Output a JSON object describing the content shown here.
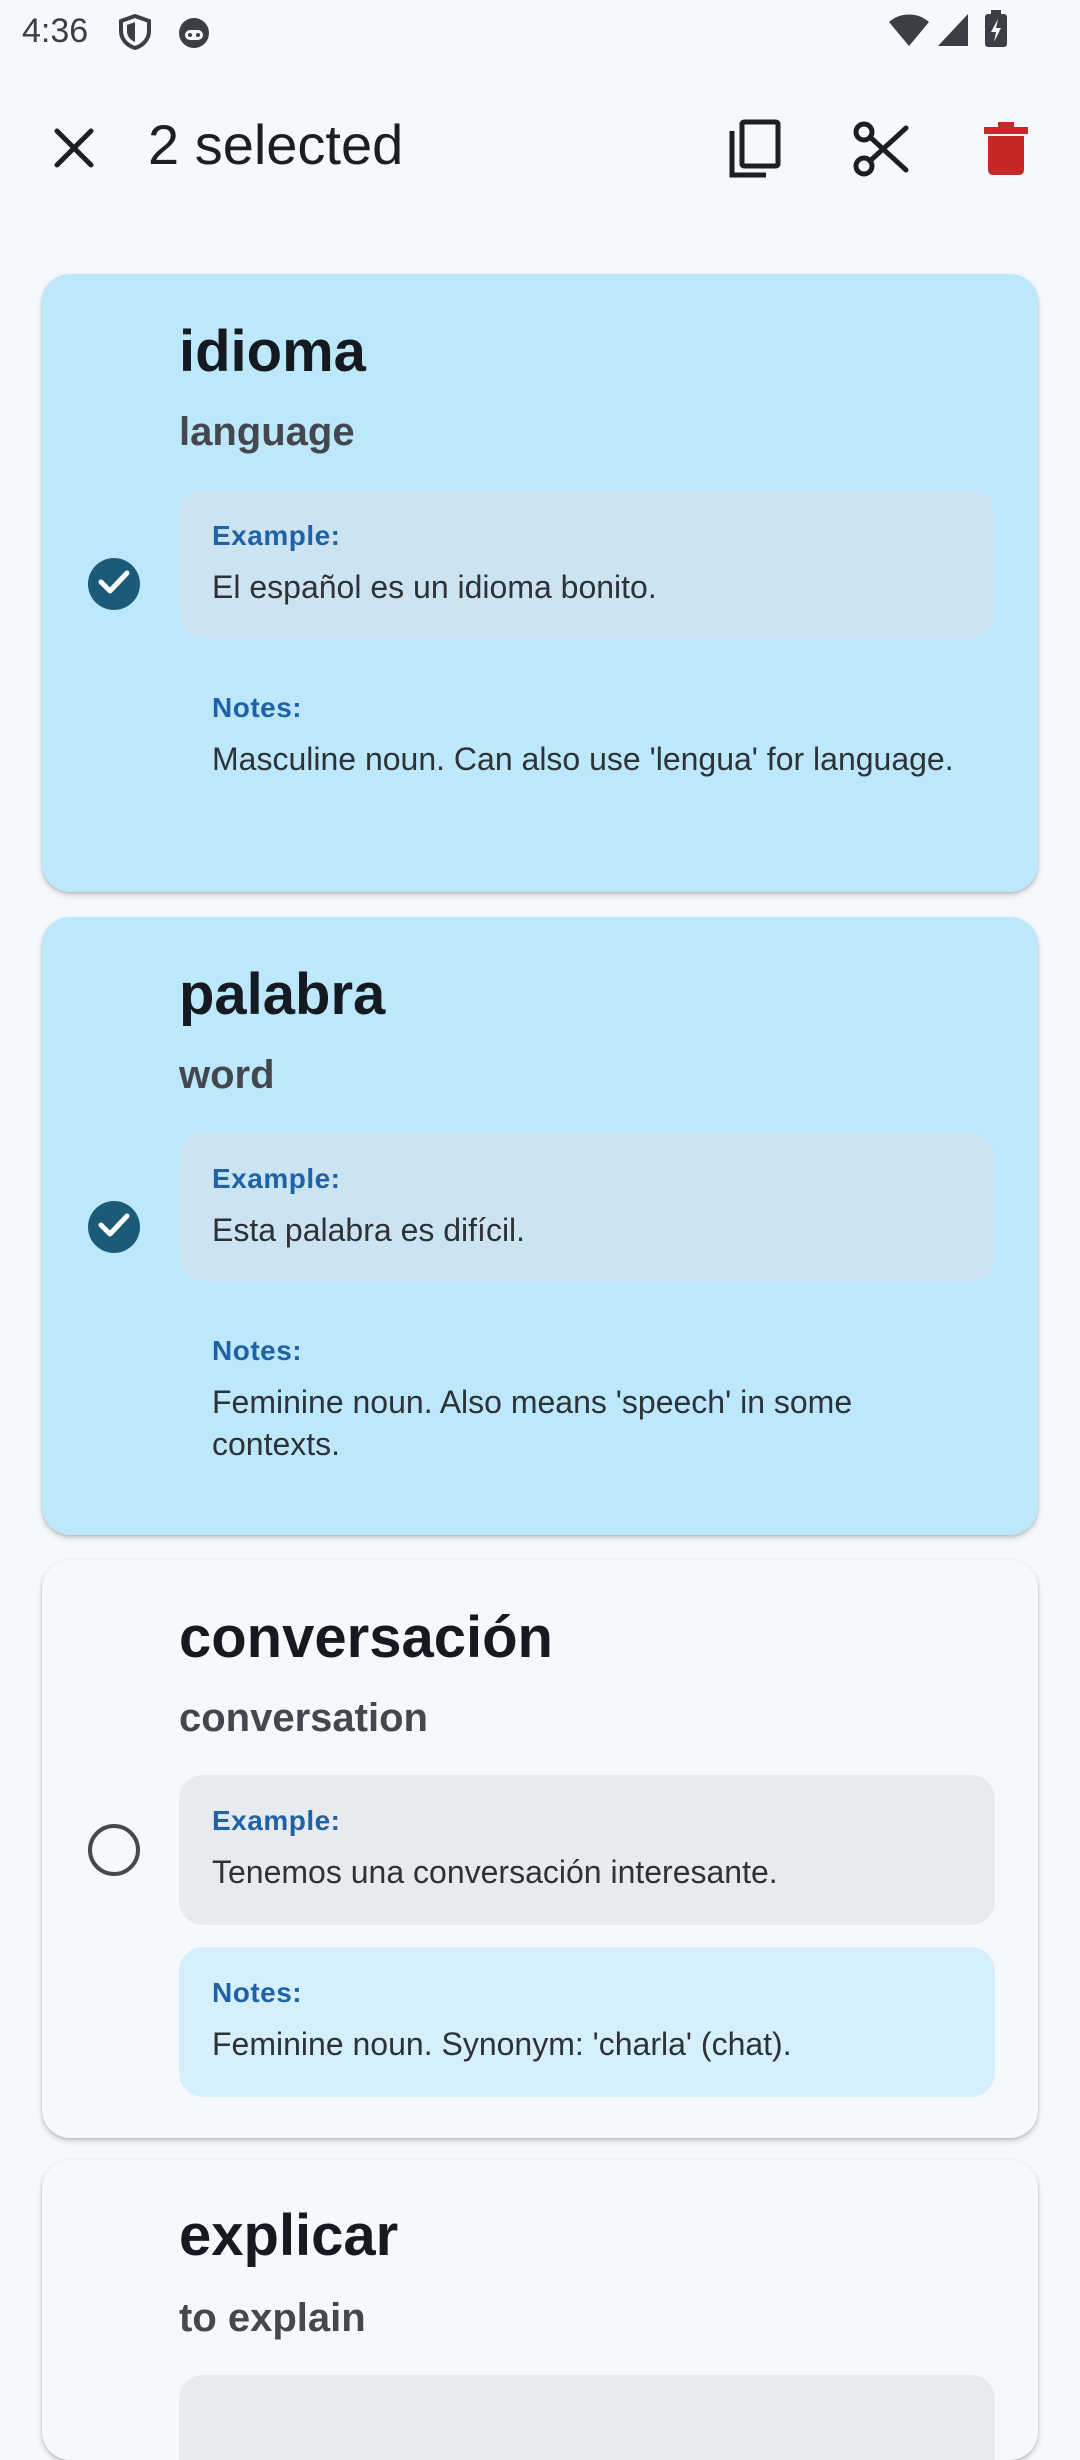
{
  "status_bar": {
    "time": "4:36",
    "icons": [
      "shield-icon",
      "android-icon",
      "wifi-icon",
      "signal-icon",
      "battery-charging-icon"
    ]
  },
  "app_bar": {
    "close_icon": "close-icon",
    "title": "2 selected",
    "actions": [
      {
        "name": "copy",
        "icon": "copy-icon"
      },
      {
        "name": "cut",
        "icon": "scissors-icon"
      },
      {
        "name": "delete",
        "icon": "trash-icon",
        "color": "#c62828"
      }
    ]
  },
  "cards": [
    {
      "term": "idioma",
      "translation": "language",
      "selected": true,
      "example_label": "Example:",
      "example": "El español es un idioma bonito.",
      "notes_label": "Notes:",
      "notes": "Masculine noun. Can also use 'lengua' for language."
    },
    {
      "term": "palabra",
      "translation": "word",
      "selected": true,
      "example_label": "Example:",
      "example": "Esta palabra es difícil.",
      "notes_label": "Notes:",
      "notes": "Feminine noun. Also means 'speech' in some contexts."
    },
    {
      "term": "conversación",
      "translation": "conversation",
      "selected": false,
      "example_label": "Example:",
      "example": "Tenemos una conversación interesante.",
      "notes_label": "Notes:",
      "notes": "Feminine noun. Synonym: 'charla' (chat)."
    },
    {
      "term": "explicar",
      "translation": "to explain",
      "selected": false
    }
  ],
  "colors": {
    "selected_card": "#bde8fb",
    "unselected_card": "#f6f9fc",
    "label_blue": "#1f63a6",
    "check_fill": "#1c5b78",
    "delete_red": "#c62828"
  }
}
